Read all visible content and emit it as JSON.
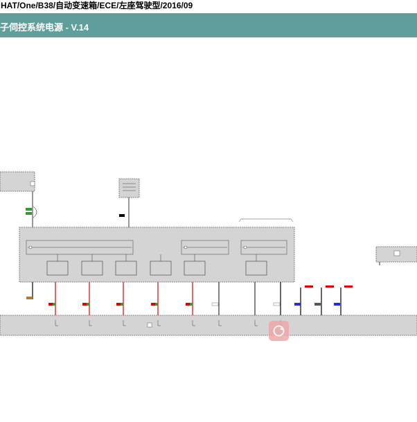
{
  "header": {
    "path_title": "HAT/One/B38/自动变速箱/ECE/左座驾驶型/2016/09",
    "section_title": "子伺控系统电源 - V.14"
  },
  "colors": {
    "banner": "#5f9e9b",
    "wire_red": "#e00000",
    "module_gray": "#d4d4d4",
    "restore_button": "#f0a8a8"
  },
  "icons": {
    "restore_button": "rotate-refresh-icon"
  }
}
